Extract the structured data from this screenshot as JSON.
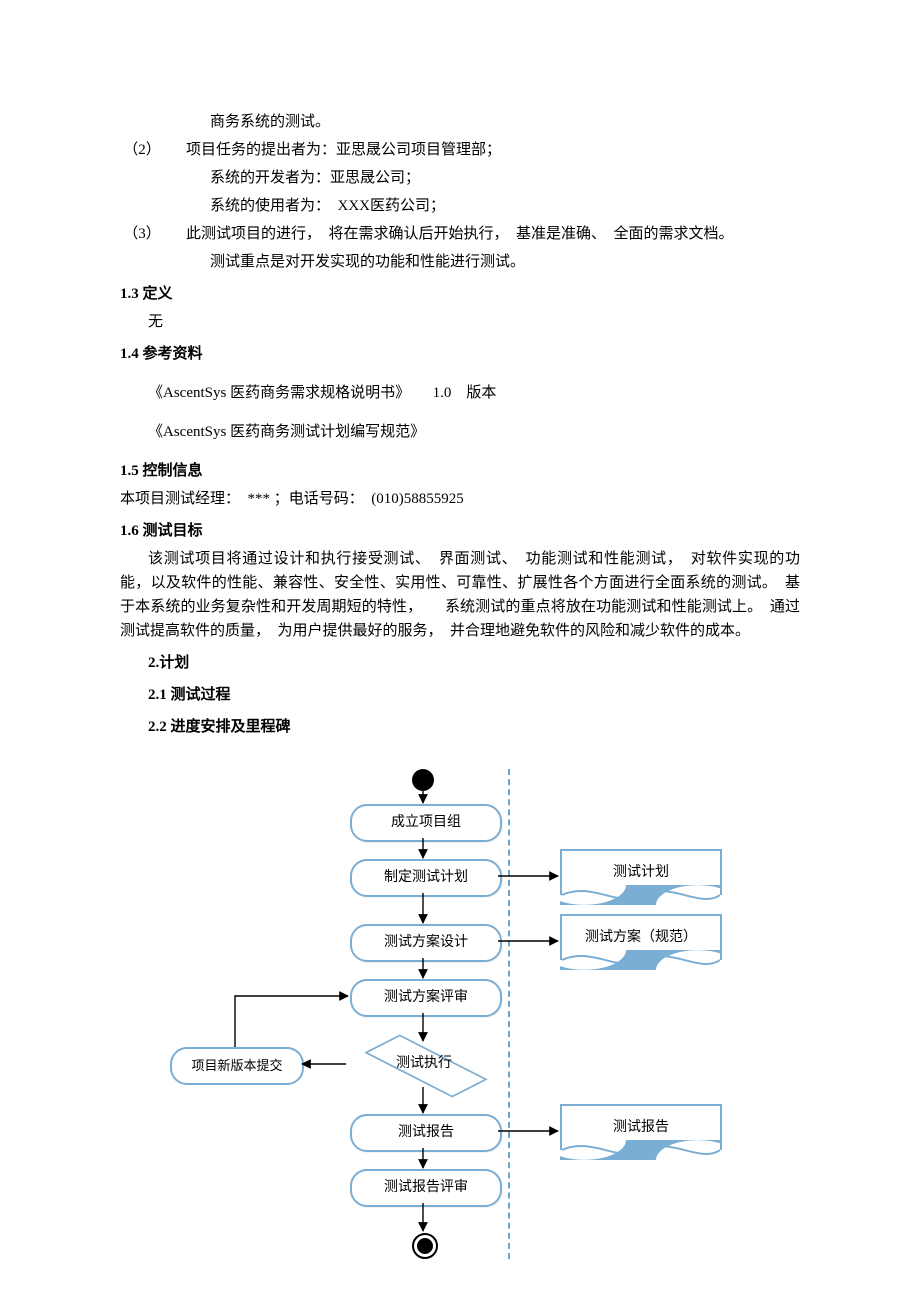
{
  "header_line": "商务系统的测试。",
  "items": {
    "i2": {
      "k": "（2）",
      "l1": "项目任务的提出者为：亚思晟公司项目管理部；",
      "l2": "系统的开发者为：亚思晟公司；",
      "l3": "系统的使用者为：　XXX医药公司；"
    },
    "i3": {
      "k": "（3）",
      "l1": "此测试项目的进行，　将在需求确认后开始执行，　基准是准确、　全面的需求文档。",
      "l2": "测试重点是对开发实现的功能和性能进行测试。"
    }
  },
  "s13": {
    "title": "1.3 定义",
    "body": "无"
  },
  "s14": {
    "title": "1.4 参考资料",
    "l1": "《AscentSys  医药商务需求规格说明书》　　1.0　版本",
    "l2": "《AscentSys  医药商务测试计划编写规范》"
  },
  "s15": {
    "title": "1.5 控制信息",
    "body": "本项目测试经理：　*** ；电话号码：　(010)58855925"
  },
  "s16": {
    "title": "1.6 测试目标",
    "body": "该测试项目将通过设计和执行接受测试、　界面测试、　功能测试和性能测试，　对软件实现的功能，以及软件的性能、兼容性、安全性、实用性、可靠性、扩展性各个方面进行全面系统的测试。　基于本系统的业务复杂性和开发周期短的特性，　　系统测试的重点将放在功能测试和性能测试上。　通过测试提高软件的质量，　为用户提供最好的服务，　并合理地避免软件的风险和减少软件的成本。"
  },
  "s2": "2.计划",
  "s21": "2.1 测试过程",
  "s22": "2.2 进度安排及里程碑",
  "chart_data": {
    "type": "flowchart",
    "nodes": [
      {
        "id": "start",
        "type": "start",
        "label": ""
      },
      {
        "id": "n1",
        "type": "process",
        "label": "成立项目组"
      },
      {
        "id": "n2",
        "type": "process",
        "label": "制定测试计划"
      },
      {
        "id": "n3",
        "type": "process",
        "label": "测试方案设计"
      },
      {
        "id": "n4",
        "type": "process",
        "label": "测试方案评审"
      },
      {
        "id": "n5",
        "type": "decision",
        "label": "测试执行"
      },
      {
        "id": "n6",
        "type": "process",
        "label": "测试报告"
      },
      {
        "id": "n7",
        "type": "process",
        "label": "测试报告评审"
      },
      {
        "id": "end",
        "type": "end",
        "label": ""
      },
      {
        "id": "fb",
        "type": "process",
        "label": "项目新版本提交"
      },
      {
        "id": "d1",
        "type": "document",
        "label": "测试计划"
      },
      {
        "id": "d2",
        "type": "document",
        "label": "测试方案（规范）"
      },
      {
        "id": "d3",
        "type": "document",
        "label": "测试报告"
      }
    ],
    "edges": [
      [
        "start",
        "n1"
      ],
      [
        "n1",
        "n2"
      ],
      [
        "n2",
        "n3"
      ],
      [
        "n3",
        "n4"
      ],
      [
        "n4",
        "n5"
      ],
      [
        "n5",
        "n6"
      ],
      [
        "n6",
        "n7"
      ],
      [
        "n7",
        "end"
      ],
      [
        "n5",
        "fb"
      ],
      [
        "fb",
        "n4"
      ],
      [
        "n2",
        "d1"
      ],
      [
        "n3",
        "d2"
      ],
      [
        "n6",
        "d3"
      ]
    ],
    "swimlane_divider": "vertical-dashed"
  }
}
